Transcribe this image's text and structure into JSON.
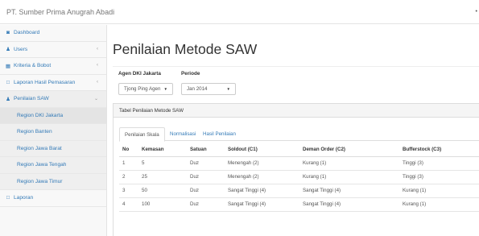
{
  "header": {
    "brand": "PT. Sumber Prima Anugrah Abadi",
    "right_mark": "•"
  },
  "sidebar": {
    "items": [
      {
        "label": "Dashboard",
        "icon": "dashboard-icon",
        "glyph": "◙",
        "chevron": ""
      },
      {
        "label": "Users",
        "icon": "user-icon",
        "glyph": "♟",
        "chevron": "‹"
      },
      {
        "label": "Kriteria & Bobot",
        "icon": "table-icon",
        "glyph": "▦",
        "chevron": "‹"
      },
      {
        "label": "Laporan Hasil Pemasaran",
        "icon": "file-icon",
        "glyph": "□",
        "chevron": "‹"
      },
      {
        "label": "Penilaian SAW",
        "icon": "users-icon",
        "glyph": "♟",
        "chevron": "⌄"
      }
    ],
    "subitems": [
      "Region DKI Jakarta",
      "Region Banten",
      "Region Jawa Barat",
      "Region Jawa Tengah",
      "Region Jawa Timur"
    ],
    "bottom": {
      "label": "Laporan",
      "icon": "file-icon",
      "glyph": "□"
    }
  },
  "main": {
    "title": "Penilaian Metode SAW",
    "agent_label": "Agen DKI Jakarta",
    "agent_value": "Tjong Ping Agen",
    "period_label": "Periode",
    "period_value": "Jan 2014",
    "caret": "▼",
    "panel_title": "Tabel Penilaian Metode SAW",
    "tabs": [
      "Penilaian Skala",
      "Normalisasi",
      "Hasil Penilaian"
    ],
    "table": {
      "headers": [
        "No",
        "Kemasan",
        "Satuan",
        "Soldout (C1)",
        "Deman Order (C2)",
        "Bufferstock (C3)"
      ],
      "rows": [
        [
          "1",
          "5",
          "Duz",
          "Menengah (2)",
          "Kurang (1)",
          "Tinggi (3)"
        ],
        [
          "2",
          "25",
          "Duz",
          "Menengah (2)",
          "Kurang (1)",
          "Tinggi (3)"
        ],
        [
          "3",
          "50",
          "Duz",
          "Sangat Tinggi (4)",
          "Sangat Tinggi (4)",
          "Kurang (1)"
        ],
        [
          "4",
          "100",
          "Duz",
          "Sangat Tinggi (4)",
          "Sangat Tinggi (4)",
          "Kurang (1)"
        ]
      ]
    }
  },
  "colors": {
    "link": "#337ab7",
    "sidebar_bg": "#f8f8f8",
    "active_bg": "#e4e4e4"
  }
}
